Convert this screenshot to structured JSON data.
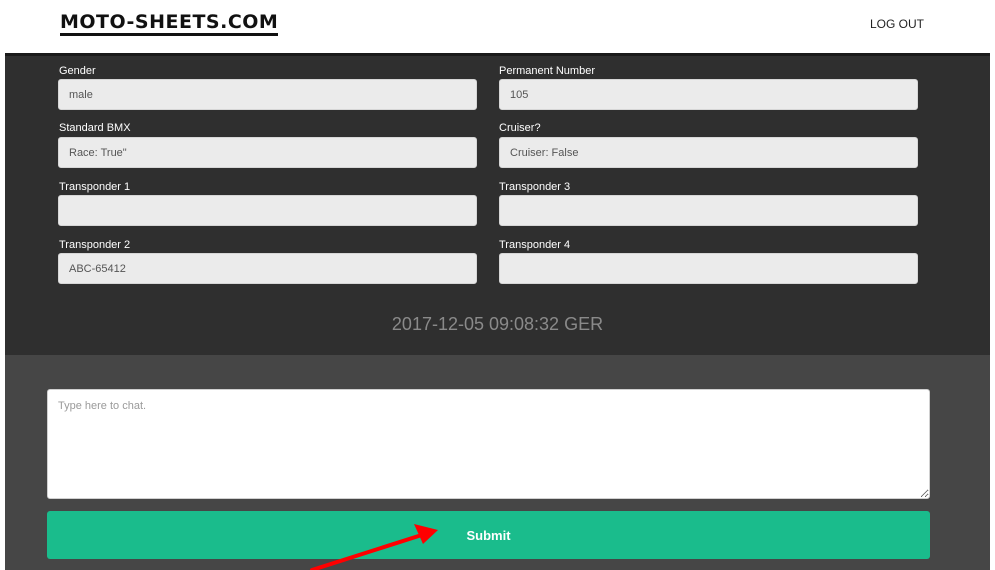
{
  "header": {
    "logo": "MOTO-SHEETS.COM",
    "logout_label": "LOG OUT"
  },
  "profile": {
    "gender": {
      "label": "Gender",
      "value": "male"
    },
    "permanent_number": {
      "label": "Permanent Number",
      "value": "105"
    },
    "standard_bmx": {
      "label": "Standard BMX",
      "value": "Race: True\""
    },
    "cruiser": {
      "label": "Cruiser?",
      "value": "Cruiser: False"
    },
    "transponder_1": {
      "label": "Transponder 1",
      "value": ""
    },
    "transponder_3": {
      "label": "Transponder 3",
      "value": ""
    },
    "transponder_2": {
      "label": "Transponder 2",
      "value": "ABC-65412"
    },
    "transponder_4": {
      "label": "Transponder 4",
      "value": ""
    },
    "timestamp": "2017-12-05 09:08:32 GER"
  },
  "chat": {
    "placeholder": "Type here to chat.",
    "submit_label": "Submit"
  },
  "colors": {
    "accent": "#1abc8c",
    "annotation_arrow": "#ff0000"
  },
  "annotation": {
    "icon": "red-arrow-icon"
  }
}
